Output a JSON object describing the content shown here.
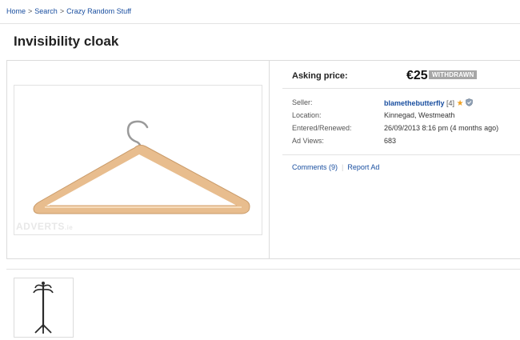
{
  "breadcrumb": {
    "items": [
      "Home",
      "Search",
      "Crazy Random Stuff"
    ],
    "separator": ">"
  },
  "listing": {
    "title": "Invisibility cloak",
    "price_label": "Asking price:",
    "price": "€25",
    "status": "WITHDRAWN",
    "watermark": "ADVERTS",
    "watermark_suffix": ".ie"
  },
  "details": {
    "seller_label": "Seller:",
    "seller_name": "blamethebutterfly",
    "seller_count": "[4]",
    "location_label": "Location:",
    "location": "Kinnegad, Westmeath",
    "entered_label": "Entered/Renewed:",
    "entered": "26/09/2013 8:16 pm (4 months ago)",
    "views_label": "Ad Views:",
    "views": "683"
  },
  "actions": {
    "comments": "Comments (9)",
    "report": "Report Ad"
  },
  "icons": {
    "star": "star-icon",
    "shield": "shield-icon",
    "hanger": "hanger-image",
    "coat_stand": "coat-stand-image"
  },
  "colors": {
    "link": "#1a4fa0",
    "badge": "#a6a6a6",
    "star": "#f0a020",
    "wood": "#e8bd8e"
  }
}
